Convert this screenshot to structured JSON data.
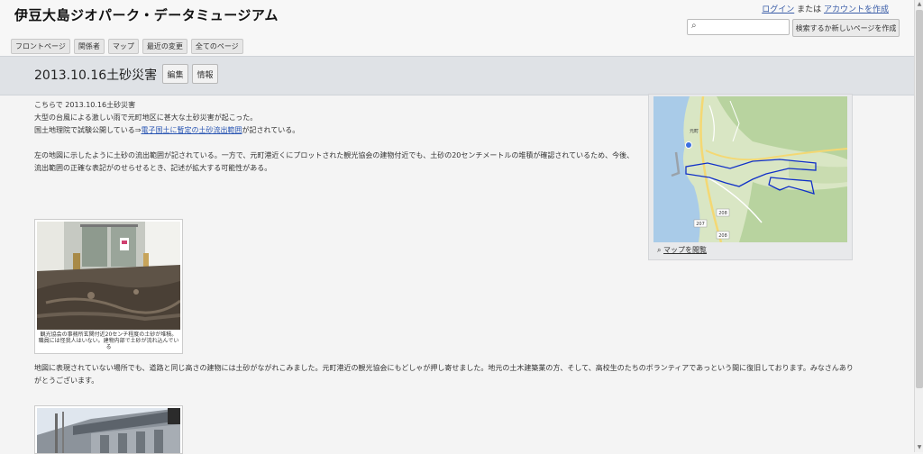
{
  "header": {
    "site_title": "伊豆大島ジオパーク・データミュージアム",
    "login": "ログイン",
    "or": "または",
    "create_account": "アカウントを作成",
    "search_placeholder": "",
    "search_button": "検索するか新しいページを作成",
    "search_icon": "search-icon"
  },
  "nav": {
    "items": [
      "フロントページ",
      "関係者",
      "マップ",
      "最近の変更",
      "全てのページ"
    ]
  },
  "page": {
    "title": "2013.10.16土砂災害",
    "edit": "編集",
    "info": "情報"
  },
  "content": {
    "line1": "こちらで 2013.10.16土砂災害",
    "line2": "大型の台風による激しい雨で元町地区に甚大な土砂災害が起こった。",
    "line3_pre": "国土地理院で試験公開している⇒",
    "line3_link": "電子国土に暫定の土砂流出範囲",
    "line3_post": "が記されている。",
    "para2": "左の地図に示したように土砂の流出範囲が記されている。一方で、元町港近くにプロットされた観光協会の建物付近でも、土砂の20センチメートルの堆積が確認されているため、今後、流出範囲の正確な表記がのせらせるとき、記述が拡大する可能性がある。",
    "photo1_caption": "観光協会の事務所玄関付近20センチ程度の土砂が堆積。職員には怪我人はいない。建物内部で土砂が流れ込んでいる",
    "para3": "地図に表現されていない場所でも、道路と同じ高さの建物には土砂がながれこみました。元町港近の観光協会にもどしゃが押し寄せました。地元の土木建築業の方、そして、高校生のたちのボランティアであっという間に復旧しております。みなさんありがとうございます。"
  },
  "map": {
    "link": "マップを閲覧",
    "label_town": "元町",
    "road1": "207",
    "road2": "208",
    "road3": "208",
    "colors": {
      "sea": "#a9cbe8",
      "land": "#d9e6c4",
      "forest": "#b8d39f",
      "road": "#f4d873",
      "outline": "#1030c8"
    }
  }
}
